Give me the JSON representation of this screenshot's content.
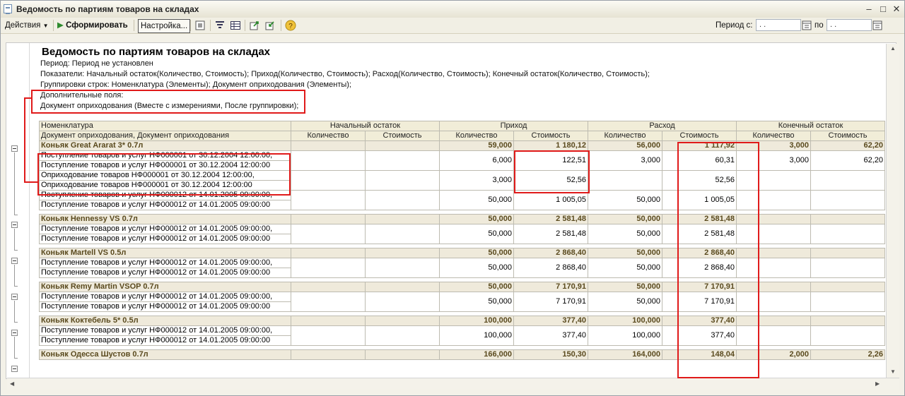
{
  "window": {
    "title": "Ведомость по партиям товаров на складах"
  },
  "toolbar": {
    "actions_label": "Действия",
    "run_label": "Сформировать",
    "settings_label": "Настройка...",
    "period_from_label": "Период с:",
    "period_to_label": "по",
    "period_from_value": " .  .",
    "period_to_value": " .  ."
  },
  "report": {
    "title": "Ведомость по партиям товаров на складах",
    "period": "Период: Период не установлен",
    "indicators": "Показатели: Начальный остаток(Количество, Стоимость); Приход(Количество, Стоимость); Расход(Количество, Стоимость); Конечный остаток(Количество, Стоимость);",
    "groupings": "Группировки строк: Номенклатура (Элементы); Документ оприходования (Элементы);",
    "extra_fields_label": "Дополнительные поля:",
    "extra_fields_value": "Документ оприходования (Вместе с измерениями, После группировки);"
  },
  "table": {
    "header1": {
      "col1": "Номенклатура",
      "start": "Начальный остаток",
      "income": "Приход",
      "expense": "Расход",
      "end": "Конечный остаток"
    },
    "header2": {
      "col1": "Документ оприходования, Документ оприходования",
      "qty": "Количество",
      "cost": "Стоимость"
    },
    "groups": [
      {
        "name": "Коньяк Great Ararat 3* 0.7л",
        "vals": [
          "",
          "",
          "59,000",
          "1 180,12",
          "56,000",
          "1 117,92",
          "3,000",
          "62,20"
        ],
        "rows": [
          {
            "l1": "Поступление товаров и услуг НФ000001 от 30.12.2004 12:00:00,",
            "l2": "Поступление товаров и услуг НФ000001 от 30.12.2004 12:00:00",
            "vals": [
              "",
              "",
              "6,000",
              "122,51",
              "3,000",
              "60,31",
              "3,000",
              "62,20"
            ]
          },
          {
            "l1": "Оприходование товаров НФ000001 от 30.12.2004 12:00:00,",
            "l2": "Оприходование товаров НФ000001 от 30.12.2004 12:00:00",
            "vals": [
              "",
              "",
              "3,000",
              "52,56",
              "",
              "52,56",
              "",
              ""
            ]
          },
          {
            "l1": "Поступление товаров и услуг НФ000012 от 14.01.2005 09:00:00,",
            "l2": "Поступление товаров и услуг НФ000012 от 14.01.2005 09:00:00",
            "vals": [
              "",
              "",
              "50,000",
              "1 005,05",
              "50,000",
              "1 005,05",
              "",
              ""
            ]
          }
        ]
      },
      {
        "name": "Коньяк Hennessy VS 0.7л",
        "vals": [
          "",
          "",
          "50,000",
          "2 581,48",
          "50,000",
          "2 581,48",
          "",
          ""
        ],
        "rows": [
          {
            "l1": "Поступление товаров и услуг НФ000012 от 14.01.2005 09:00:00,",
            "l2": "Поступление товаров и услуг НФ000012 от 14.01.2005 09:00:00",
            "vals": [
              "",
              "",
              "50,000",
              "2 581,48",
              "50,000",
              "2 581,48",
              "",
              ""
            ]
          }
        ]
      },
      {
        "name": "Коньяк Martell VS 0.5л",
        "vals": [
          "",
          "",
          "50,000",
          "2 868,40",
          "50,000",
          "2 868,40",
          "",
          ""
        ],
        "rows": [
          {
            "l1": "Поступление товаров и услуг НФ000012 от 14.01.2005 09:00:00,",
            "l2": "Поступление товаров и услуг НФ000012 от 14.01.2005 09:00:00",
            "vals": [
              "",
              "",
              "50,000",
              "2 868,40",
              "50,000",
              "2 868,40",
              "",
              ""
            ]
          }
        ]
      },
      {
        "name": "Коньяк Remy Martin VSOP 0.7л",
        "vals": [
          "",
          "",
          "50,000",
          "7 170,91",
          "50,000",
          "7 170,91",
          "",
          ""
        ],
        "rows": [
          {
            "l1": "Поступление товаров и услуг НФ000012 от 14.01.2005 09:00:00,",
            "l2": "Поступление товаров и услуг НФ000012 от 14.01.2005 09:00:00",
            "vals": [
              "",
              "",
              "50,000",
              "7 170,91",
              "50,000",
              "7 170,91",
              "",
              ""
            ]
          }
        ]
      },
      {
        "name": "Коньяк Коктебель 5* 0.5л",
        "vals": [
          "",
          "",
          "100,000",
          "377,40",
          "100,000",
          "377,40",
          "",
          ""
        ],
        "rows": [
          {
            "l1": "Поступление товаров и услуг НФ000012 от 14.01.2005 09:00:00,",
            "l2": "Поступление товаров и услуг НФ000012 от 14.01.2005 09:00:00",
            "vals": [
              "",
              "",
              "100,000",
              "377,40",
              "100,000",
              "377,40",
              "",
              ""
            ]
          }
        ]
      },
      {
        "name": "Коньяк Одесса Шустов 0.7л",
        "vals": [
          "",
          "",
          "166,000",
          "150,30",
          "164,000",
          "148,04",
          "2,000",
          "2,26"
        ],
        "rows": []
      }
    ]
  },
  "colors": {
    "highlight": "#e01a1a",
    "group_text": "#5a4a1e",
    "header_bg": "#f1edd8"
  }
}
